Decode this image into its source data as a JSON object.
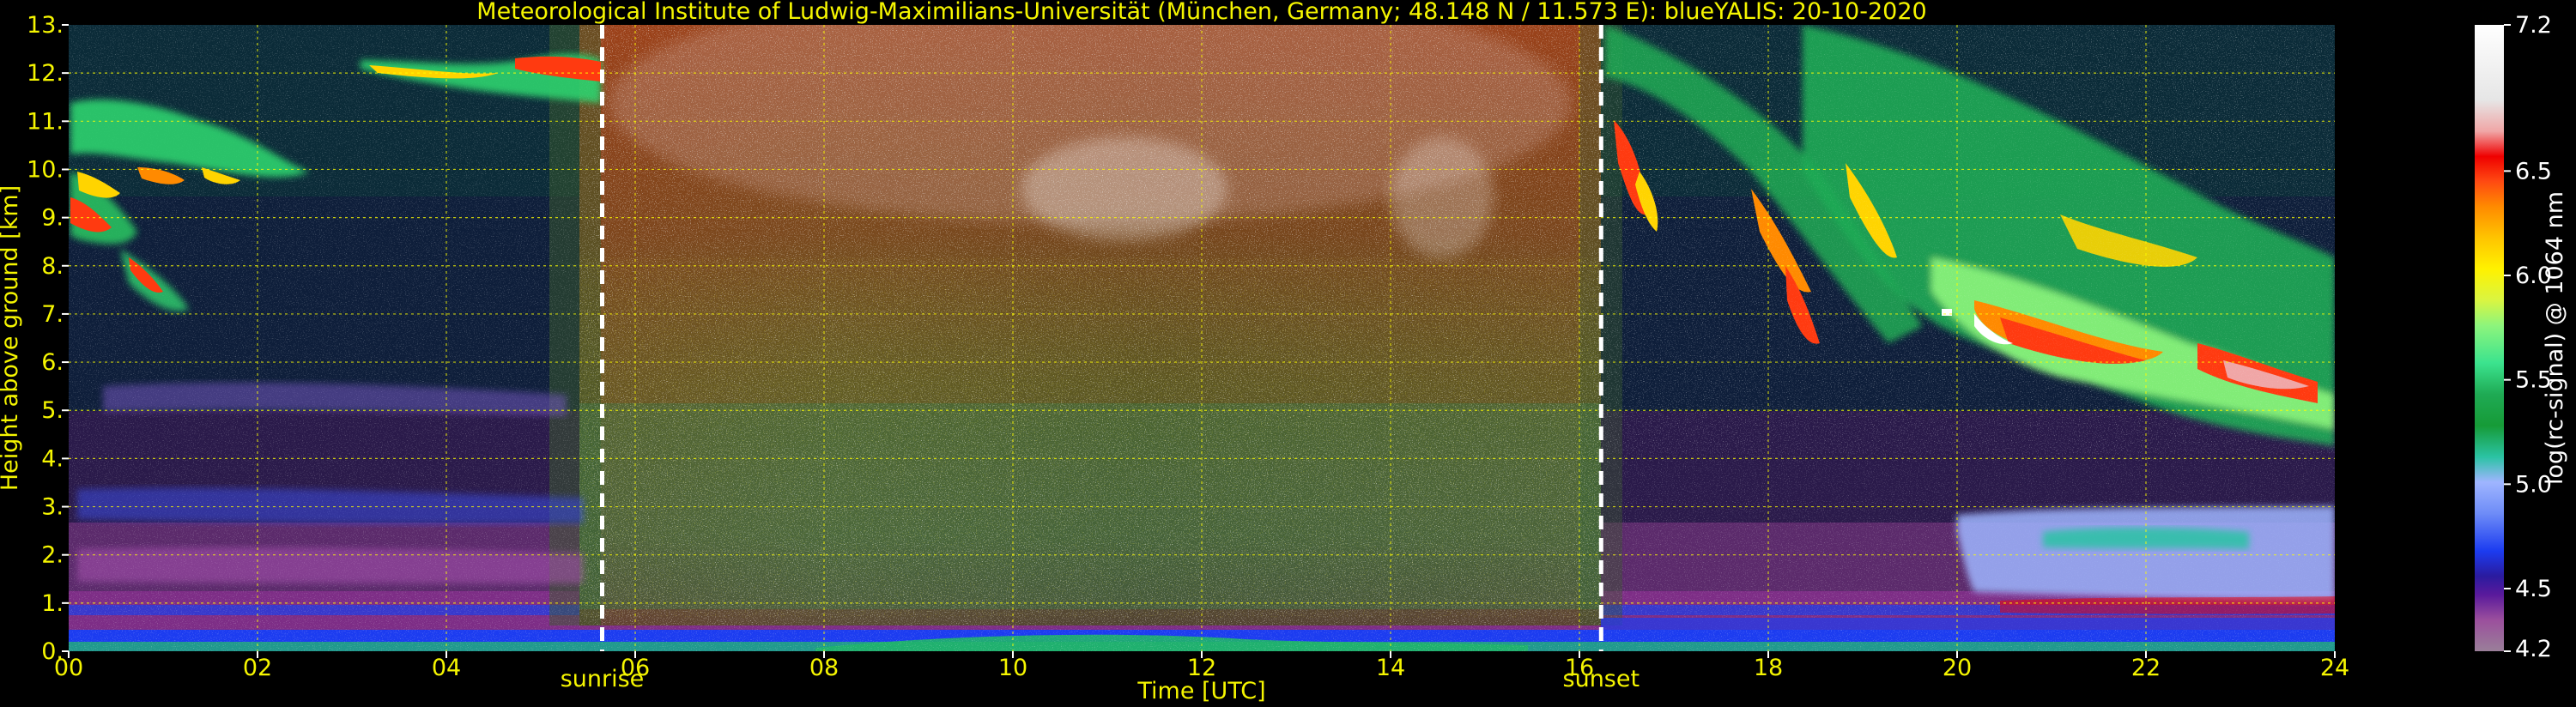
{
  "chart_data": {
    "type": "heatmap",
    "title": "Meteorological Institute of Ludwig-Maximilians-Universität (München, Germany; 48.148 N / 11.573 E):    blueYALIS: 20-10-2020",
    "xlabel": "Time [UTC]",
    "ylabel": "Height above ground [km]",
    "colorbar_label": "log(rc-signal) @ 1064 nm",
    "xlim": [
      0,
      24
    ],
    "ylim": [
      0,
      13
    ],
    "x_ticks": [
      "00",
      "02",
      "04",
      "06",
      "08",
      "10",
      "12",
      "14",
      "16",
      "18",
      "20",
      "22",
      "24"
    ],
    "y_ticks": [
      "0.",
      "1.",
      "2.",
      "3.",
      "4.",
      "5.",
      "6.",
      "7.",
      "8.",
      "9.",
      "10.",
      "11.",
      "12.",
      "13."
    ],
    "colorbar_range": [
      4.2,
      7.2
    ],
    "colorbar_ticks": [
      "4.2",
      "4.5",
      "5.0",
      "5.5",
      "6.0",
      "6.5",
      "7.2"
    ],
    "colorbar_tick_values": [
      4.2,
      4.5,
      5.0,
      5.5,
      6.0,
      6.5,
      7.2
    ],
    "markers": [
      {
        "label": "sunrise",
        "x": 5.65
      },
      {
        "label": "sunset",
        "x": 16.23
      }
    ],
    "grid": true,
    "colors": {
      "text_accent": "#f5f500",
      "marker_line": "#ffffff",
      "grid": "#ffff00",
      "background": "#000000"
    }
  }
}
